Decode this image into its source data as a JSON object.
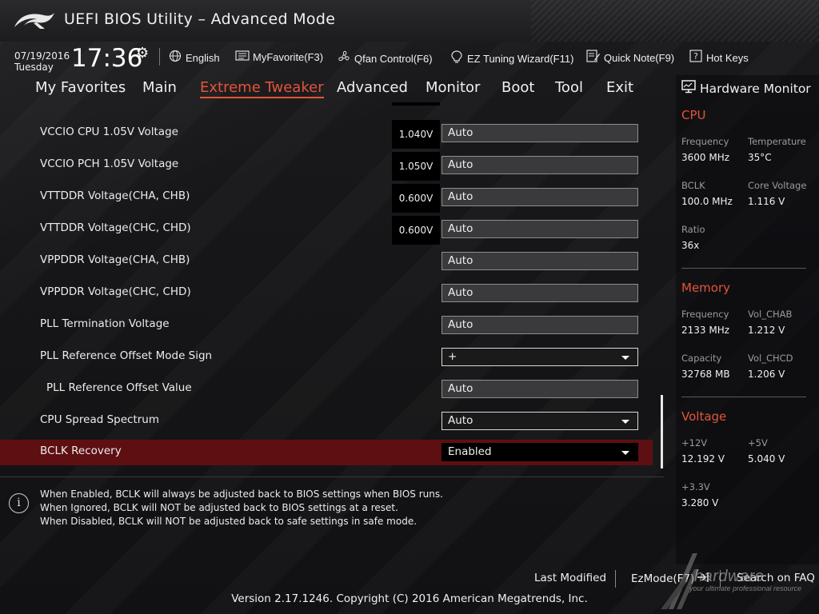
{
  "title": "UEFI BIOS Utility – Advanced Mode",
  "date": "07/19/2016",
  "weekday": "Tuesday",
  "time": "17:36",
  "toolbar": {
    "language": "English",
    "myfavorite": "MyFavorite(F3)",
    "qfan": "Qfan Control(F6)",
    "ez_tuning": "EZ Tuning Wizard(F11)",
    "quick_note": "Quick Note(F9)",
    "hot_keys": "Hot Keys"
  },
  "tabs": [
    "My Favorites",
    "Main",
    "Extreme Tweaker",
    "Advanced",
    "Monitor",
    "Boot",
    "Tool",
    "Exit"
  ],
  "active_tab": "Extreme Tweaker",
  "settings": [
    {
      "label": "VCCIO CPU 1.05V Voltage",
      "voltage": "1.040V",
      "value": "Auto"
    },
    {
      "label": "VCCIO PCH 1.05V Voltage",
      "voltage": "1.050V",
      "value": "Auto"
    },
    {
      "label": "VTTDDR Voltage(CHA, CHB)",
      "voltage": "0.600V",
      "value": "Auto"
    },
    {
      "label": "VTTDDR Voltage(CHC, CHD)",
      "voltage": "0.600V",
      "value": "Auto"
    },
    {
      "label": "VPPDDR Voltage(CHA, CHB)",
      "value": "Auto"
    },
    {
      "label": "VPPDDR Voltage(CHC, CHD)",
      "value": "Auto"
    },
    {
      "label": "PLL Termination Voltage",
      "value": "Auto"
    },
    {
      "label": "PLL Reference Offset Mode Sign",
      "value": "+"
    },
    {
      "label": "PLL Reference Offset Value",
      "value": "Auto"
    },
    {
      "label": "CPU Spread Spectrum",
      "value": "Auto"
    },
    {
      "label": "BCLK Recovery",
      "value": "Enabled"
    }
  ],
  "help": [
    "When Enabled, BCLK will always be adjusted back to BIOS settings when BIOS runs.",
    "When Ignored, BCLK will NOT be adjusted back to BIOS settings at a reset.",
    "When Disabled, BCLK will NOT be adjusted back to safe settings in safe mode."
  ],
  "monitor": {
    "title": "Hardware Monitor",
    "cpu": {
      "heading": "CPU",
      "frequency_label": "Frequency",
      "frequency": "3600 MHz",
      "temperature_label": "Temperature",
      "temperature": "35°C",
      "bclk_label": "BCLK",
      "bclk": "100.0 MHz",
      "core_voltage_label": "Core Voltage",
      "core_voltage": "1.116 V",
      "ratio_label": "Ratio",
      "ratio": "36x"
    },
    "memory": {
      "heading": "Memory",
      "frequency_label": "Frequency",
      "frequency": "2133 MHz",
      "vol_chab_label": "Vol_CHAB",
      "vol_chab": "1.212 V",
      "capacity_label": "Capacity",
      "capacity": "32768 MB",
      "vol_chcd_label": "Vol_CHCD",
      "vol_chcd": "1.206 V"
    },
    "voltage": {
      "heading": "Voltage",
      "v12_label": "+12V",
      "v12": "12.192 V",
      "v5_label": "+5V",
      "v5": "5.040 V",
      "v33_label": "+3.3V",
      "v33": "3.280 V"
    }
  },
  "bottom": {
    "last_modified": "Last Modified",
    "ezmode": "EzMode(F7)",
    "search": "Search on FAQ",
    "version": "Version 2.17.1246. Copyright (C) 2016 American Megatrends, Inc."
  },
  "watermark": {
    "text": "hardware",
    "sub": "your ultimate professional resource"
  },
  "colors": {
    "accent": "#e3543a",
    "selected_row": "#5e0f12",
    "background": "#141416"
  }
}
